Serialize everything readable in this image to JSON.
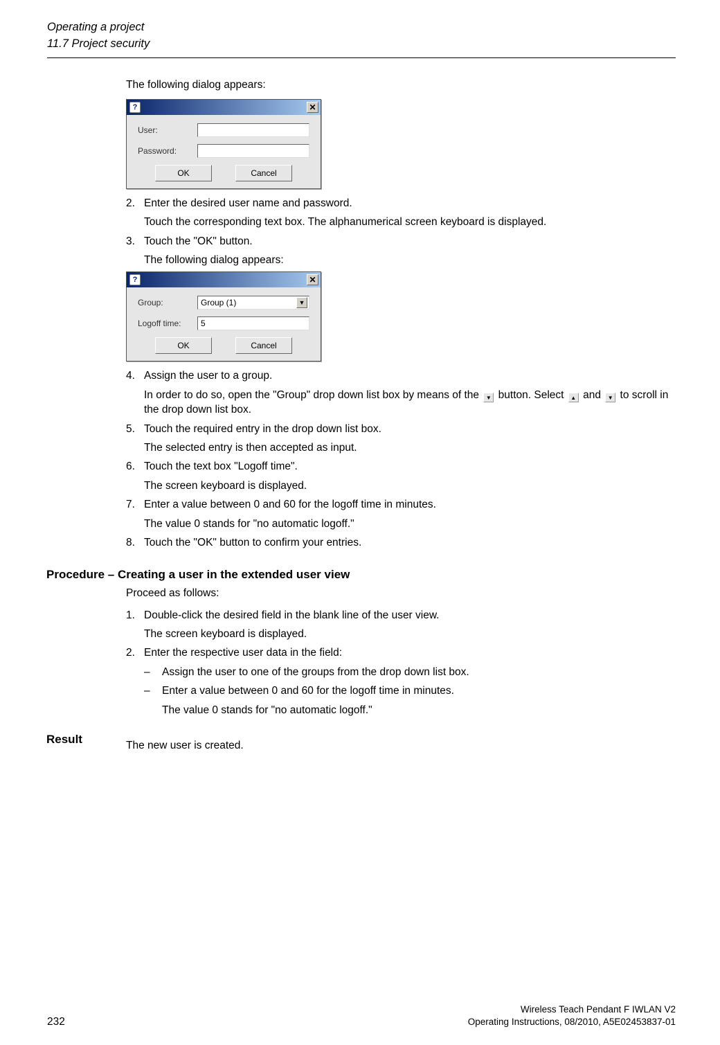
{
  "header": {
    "chapter": "Operating a project",
    "section": "11.7 Project security"
  },
  "intro1": "The following dialog appears:",
  "dialog1": {
    "user_label": "User:",
    "password_label": "Password:",
    "user_value": "",
    "password_value": "",
    "ok": "OK",
    "cancel": "Cancel"
  },
  "steps_a": {
    "s2_num": "2.",
    "s2_text": "Enter the desired user name and password.",
    "s2_sub": "Touch the corresponding text box. The alphanumerical screen keyboard is displayed.",
    "s3_num": "3.",
    "s3_text": "Touch the \"OK\" button.",
    "s3_sub": "The following dialog appears:"
  },
  "dialog2": {
    "group_label": "Group:",
    "logoff_label": "Logoff time:",
    "group_value": "Group (1)",
    "logoff_value": "5",
    "ok": "OK",
    "cancel": "Cancel"
  },
  "steps_b": {
    "s4_num": "4.",
    "s4_text": "Assign the user to a group.",
    "s4_sub_a": "In order to do so, open the \"Group\" drop down list box by means of the ",
    "s4_sub_b": " button. Select ",
    "s4_sub_c": " and ",
    "s4_sub_d": " to scroll in the drop down list box.",
    "s5_num": "5.",
    "s5_text": "Touch the required entry in the drop down list box.",
    "s5_sub": "The selected entry is then accepted as input.",
    "s6_num": "6.",
    "s6_text": "Touch the text box \"Logoff time\".",
    "s6_sub": "The screen keyboard is displayed.",
    "s7_num": "7.",
    "s7_text": "Enter a value between 0 and 60 for the logoff time in minutes.",
    "s7_sub": "The value 0 stands for \"no automatic logoff.\"",
    "s8_num": "8.",
    "s8_text": "Touch the \"OK\" button to confirm your entries."
  },
  "proc2_heading": "Procedure – Creating a user in the extended user view",
  "proc2_intro": "Proceed as follows:",
  "proc2": {
    "s1_num": "1.",
    "s1_text": "Double-click the desired field in the blank line of the user view.",
    "s1_sub": "The screen keyboard is displayed.",
    "s2_num": "2.",
    "s2_text": "Enter the respective user data in the field:",
    "b1": "Assign the user to one of the groups from the drop down list box.",
    "b2": "Enter a value between 0 and 60 for the logoff time in minutes.",
    "b2_sub": "The value 0 stands for \"no automatic logoff.\""
  },
  "result_heading": "Result",
  "result_text": "The new user is created.",
  "footer": {
    "page": "232",
    "line1": "Wireless Teach Pendant F IWLAN V2",
    "line2": "Operating Instructions, 08/2010, A5E02453837-01"
  }
}
